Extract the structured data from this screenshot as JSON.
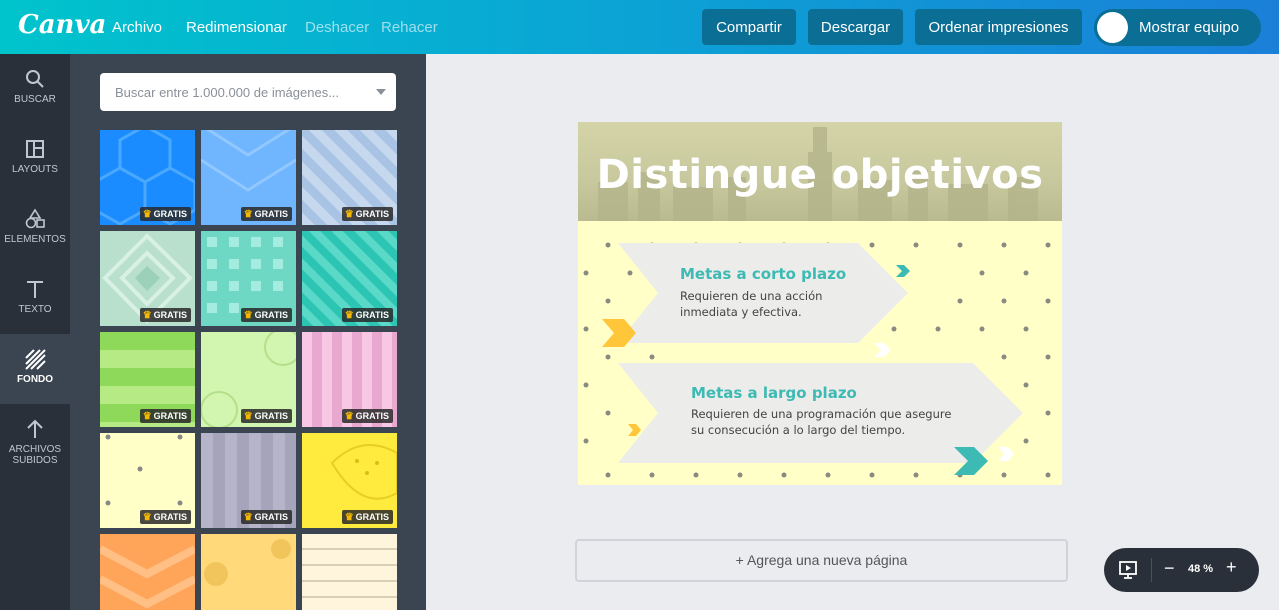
{
  "app": {
    "logo": "Canva"
  },
  "topbar": {
    "menu": [
      "Archivo",
      "Redimensionar",
      "Deshacer",
      "Rehacer"
    ],
    "share": "Compartir",
    "download": "Descargar",
    "order": "Ordenar impresiones",
    "team": "Mostrar equipo"
  },
  "rail": {
    "items": [
      {
        "label": "BUSCAR",
        "icon": "search-icon"
      },
      {
        "label": "LAYOUTS",
        "icon": "layouts-icon"
      },
      {
        "label": "ELEMENTOS",
        "icon": "shapes-icon"
      },
      {
        "label": "TEXTO",
        "icon": "text-icon"
      },
      {
        "label": "FONDO",
        "icon": "background-icon"
      },
      {
        "label": "ARCHIVOS",
        "label2": "SUBIDOS",
        "icon": "upload-icon"
      }
    ]
  },
  "panel": {
    "search_placeholder": "Buscar entre 1.000.000 de imágenes...",
    "badge": "GRATIS"
  },
  "design": {
    "title": "Distingue objetivos",
    "goal1_title": "Metas a corto plazo",
    "goal1_line1": "Requieren de una acción",
    "goal1_line2": "inmediata y efectiva.",
    "goal2_title": "Metas a largo plazo",
    "goal2_line1": "Requieren de una programación que asegure",
    "goal2_line2": "su consecución a lo largo del tiempo."
  },
  "canvas": {
    "add_page": "+ Agrega una nueva página",
    "zoom": "48 %",
    "zoom_minus": "−",
    "zoom_plus": "+"
  },
  "colors": {
    "accent": "#00c4cc",
    "brand": "#1a7fd8",
    "title": "#3dbab3"
  }
}
